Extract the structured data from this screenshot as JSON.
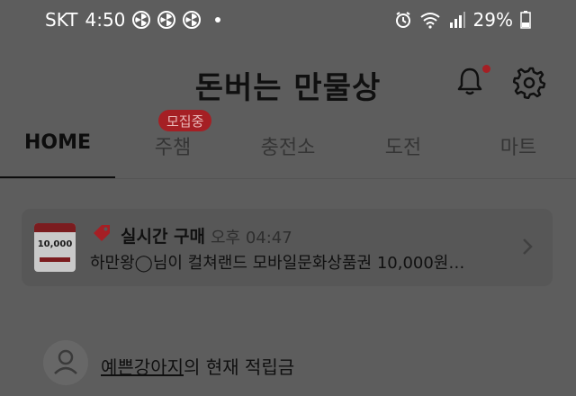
{
  "status_bar": {
    "carrier": "SKT",
    "time": "4:50",
    "battery": "29%",
    "icons": [
      "fan-icon",
      "fan-icon",
      "fan-icon",
      "alarm-icon",
      "wifi-icon",
      "signal-icon",
      "battery-icon"
    ]
  },
  "header": {
    "title": "돈버는 만물상",
    "icons": [
      "bell-icon",
      "gear-icon"
    ],
    "notification_dot_color": "#a51f24"
  },
  "tabs": {
    "items": [
      {
        "label": "HOME",
        "active": true
      },
      {
        "label": "주챔",
        "active": false,
        "badge": "모집중"
      },
      {
        "label": "충전소",
        "active": false
      },
      {
        "label": "도전",
        "active": false
      },
      {
        "label": "마트",
        "active": false
      }
    ]
  },
  "live_purchase": {
    "label": "실시간 구매",
    "time": "오후 04:47",
    "message": "하만왕◯님이 컬쳐랜드 모바일문화상품권 10,000원…",
    "thumbnail_amount": "10,000",
    "icon": "tag-icon",
    "accent_color": "#a51f24"
  },
  "savings": {
    "username": "예쁜강아지",
    "suffix": "의 현재 적립금"
  }
}
